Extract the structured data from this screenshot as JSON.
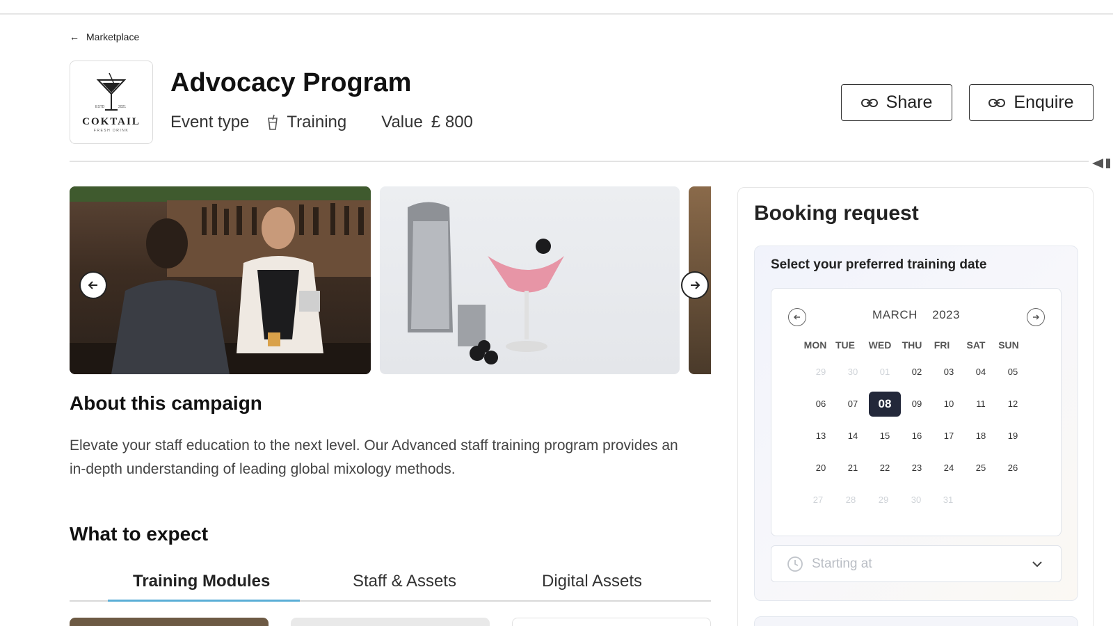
{
  "breadcrumb": {
    "label": "Marketplace"
  },
  "logo": {
    "word": "COKTAIL",
    "left": "ESTD",
    "right": "2021",
    "sub": "FRESH DRINK"
  },
  "header": {
    "title": "Advocacy Program",
    "event_type_label": "Event type",
    "event_type_value": "Training",
    "value_label": "Value",
    "value_amount": "£ 800"
  },
  "actions": {
    "share": "Share",
    "enquire": "Enquire"
  },
  "about": {
    "heading": "About this campaign",
    "text": "Elevate your staff education to the next level. Our Advanced staff training program provides an in-depth understanding of leading global mixology methods."
  },
  "expect": {
    "heading": "What to expect"
  },
  "tabs": [
    "Training Modules",
    "Staff & Assets",
    "Digital Assets"
  ],
  "booking": {
    "title": "Booking request",
    "subtitle": "Select your preferred training date",
    "month": "MARCH",
    "year": "2023",
    "weekdays": [
      "MON",
      "TUE",
      "WED",
      "THU",
      "FRI",
      "SAT",
      "SUN"
    ],
    "selected_day": "08",
    "time_placeholder": "Starting at"
  },
  "colors": {
    "selected_day": "#23283a",
    "tab_underline": "#5aaed6"
  }
}
